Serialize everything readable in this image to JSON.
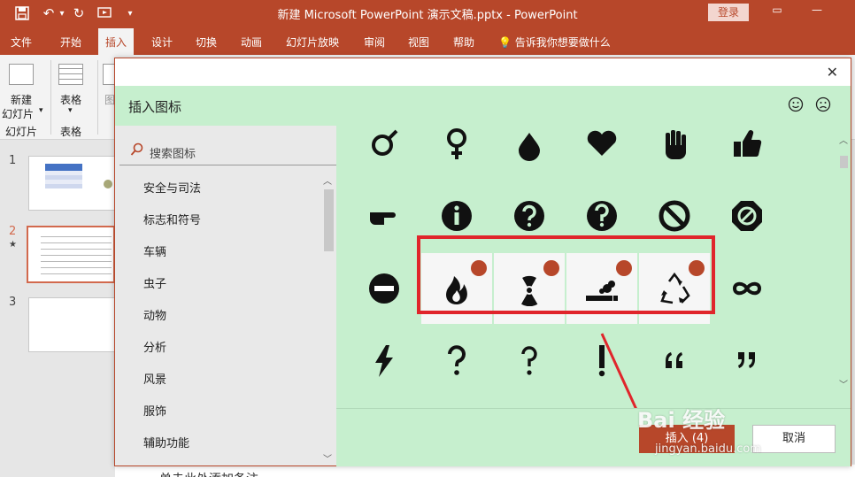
{
  "titlebar": {
    "title": "新建 Microsoft PowerPoint 演示文稿.pptx  -  PowerPoint",
    "login": "登录"
  },
  "tabs": [
    "文件",
    "开始",
    "插入",
    "设计",
    "切换",
    "动画",
    "幻灯片放映",
    "审阅",
    "视图",
    "帮助"
  ],
  "active_tab": "插入",
  "tell_me": "告诉我你想要做什么",
  "ribbon": {
    "new_slide_line1": "新建",
    "new_slide_line2": "幻灯片",
    "slides_group": "幻灯片",
    "table": "表格",
    "table_group": "表格",
    "image_cut": "图"
  },
  "slides": {
    "numbers": [
      "1",
      "2",
      "3"
    ],
    "star": "★"
  },
  "dialog": {
    "title": "插入图标",
    "search_placeholder": "搜索图标",
    "categories": [
      "安全与司法",
      "标志和符号",
      "车辆",
      "虫子",
      "动物",
      "分析",
      "风景",
      "服饰",
      "辅助功能"
    ],
    "insert_button": "插入 (4)",
    "cancel_button": "取消",
    "selected_count": 4
  },
  "icons": [
    [
      "gender-symbol-icon",
      "female-symbol-icon",
      "water-drop-icon",
      "heart-icon",
      "stop-hand-icon",
      "thumbs-up-icon"
    ],
    [
      "pointing-hand-icon",
      "information-icon",
      "question-circle-icon",
      "question-hook-circle-icon",
      "prohibited-icon",
      "no-entry-octagon-icon"
    ],
    [
      "do-not-enter-icon",
      "fire-icon",
      "radiation-icon",
      "smoking-icon",
      "recycle-icon",
      "infinity-icon"
    ],
    [
      "lightning-icon",
      "question-mark-icon",
      "question-hook-icon",
      "exclamation-icon",
      "open-quote-icon",
      "close-quote-icon"
    ]
  ],
  "selected_icons": [
    "fire-icon",
    "radiation-icon",
    "smoking-icon",
    "recycle-icon"
  ],
  "watermark": "Bai 经验",
  "watermark_sub": "jingyan.baidu.com",
  "edit_peek": "单击此处添加备注",
  "colors": {
    "accent": "#b7472a",
    "dialog_green": "#c6efce",
    "selection_red": "#e0252b"
  }
}
